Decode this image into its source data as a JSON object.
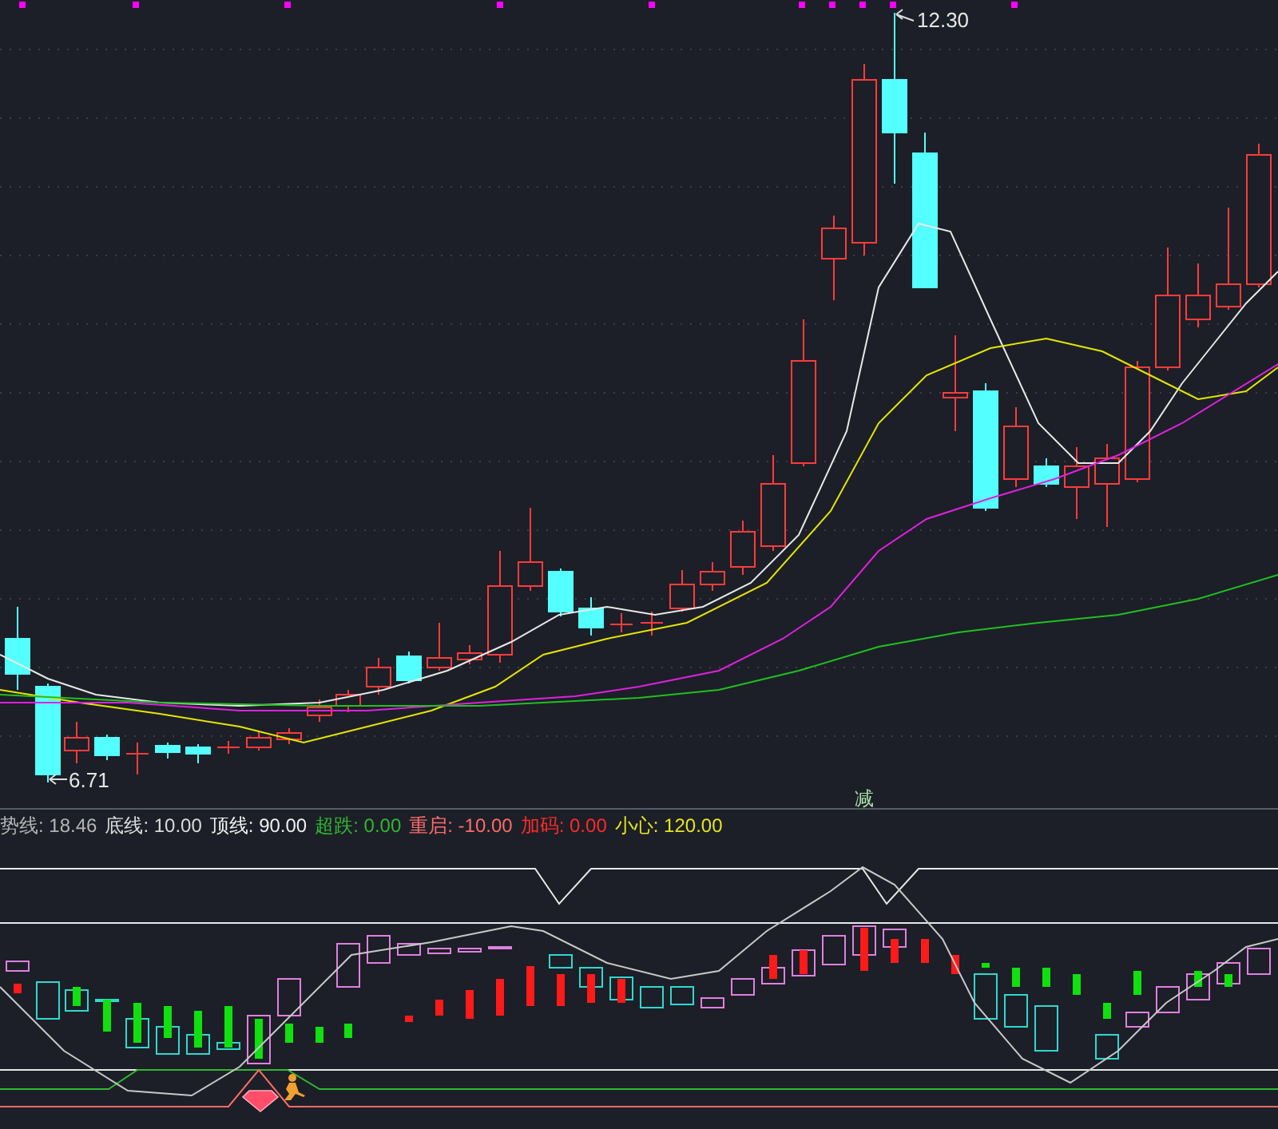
{
  "price_chart": {
    "high_label": "12.30",
    "low_label": "6.71",
    "signal_label": "减"
  },
  "indicator": {
    "legend": [
      {
        "label": "势线: 18.46",
        "color": "#b4b4b4"
      },
      {
        "label": "底线: 10.00",
        "color": "#dcdcdc"
      },
      {
        "label": "顶线: 90.00",
        "color": "#f0f0f0"
      },
      {
        "label": "超跌: 0.00",
        "color": "#2fb82f"
      },
      {
        "label": "重启: -10.00",
        "color": "#ff6b6b"
      },
      {
        "label": "加码: 0.00",
        "color": "#ff2a2a"
      },
      {
        "label": "小心: 120.00",
        "color": "#e6e61e"
      }
    ]
  }
}
